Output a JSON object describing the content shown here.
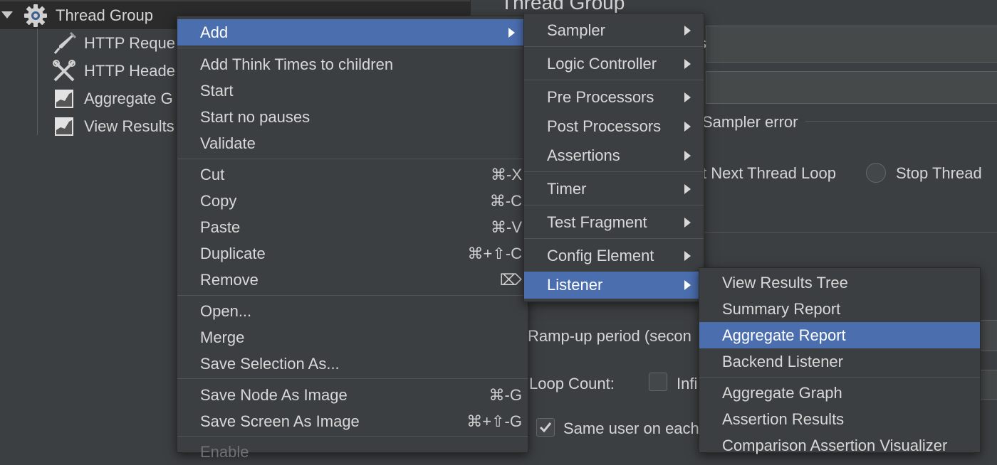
{
  "tree": {
    "root": {
      "label": "Thread Group",
      "icon": "gear-icon"
    },
    "children": [
      {
        "label": "HTTP Reque",
        "icon": "pipette-icon"
      },
      {
        "label": "HTTP Heade",
        "icon": "wrench-screwdriver-icon"
      },
      {
        "label": "Aggregate G",
        "icon": "graph-icon"
      },
      {
        "label": "View Results",
        "icon": "graph-icon"
      }
    ]
  },
  "form": {
    "title": "Thread Group",
    "field_fragment": "s",
    "error_action_label": "Sampler error",
    "radio_next_loop": "t Next Thread Loop",
    "radio_stop_thread": "Stop Thread",
    "ramp_up_label": "Ramp-up period (secon",
    "loop_count_label": "Loop Count:",
    "infinite_label": "Infi",
    "same_user_label": "Same user on each"
  },
  "context_menu": {
    "add": "Add",
    "add_think_times": "Add Think Times to children",
    "start": "Start",
    "start_no_pauses": "Start no pauses",
    "validate": "Validate",
    "cut": "Cut",
    "cut_shortcut": "⌘-X",
    "copy": "Copy",
    "copy_shortcut": "⌘-C",
    "paste": "Paste",
    "paste_shortcut": "⌘-V",
    "duplicate": "Duplicate",
    "duplicate_shortcut": "⌘+⇧-C",
    "remove": "Remove",
    "remove_shortcut": "⌦",
    "open": "Open...",
    "merge": "Merge",
    "save_selection_as": "Save Selection As...",
    "save_node_as_image": "Save Node As Image",
    "save_node_shortcut": "⌘-G",
    "save_screen_as_image": "Save Screen As Image",
    "save_screen_shortcut": "⌘+⇧-G",
    "enable": "Enable"
  },
  "add_submenu": {
    "sampler": "Sampler",
    "logic_controller": "Logic Controller",
    "pre_processors": "Pre Processors",
    "post_processors": "Post Processors",
    "assertions": "Assertions",
    "timer": "Timer",
    "test_fragment": "Test Fragment",
    "config_element": "Config Element",
    "listener": "Listener"
  },
  "listener_submenu": {
    "view_results_tree": "View Results Tree",
    "summary_report": "Summary Report",
    "aggregate_report": "Aggregate Report",
    "backend_listener": "Backend Listener",
    "aggregate_graph": "Aggregate Graph",
    "assertion_results": "Assertion Results",
    "comparison_assertion_visualizer": "Comparison Assertion Visualizer"
  },
  "colors": {
    "background": "#3c3f41",
    "selection": "#4b6eaf",
    "text": "#d8d8d8"
  }
}
